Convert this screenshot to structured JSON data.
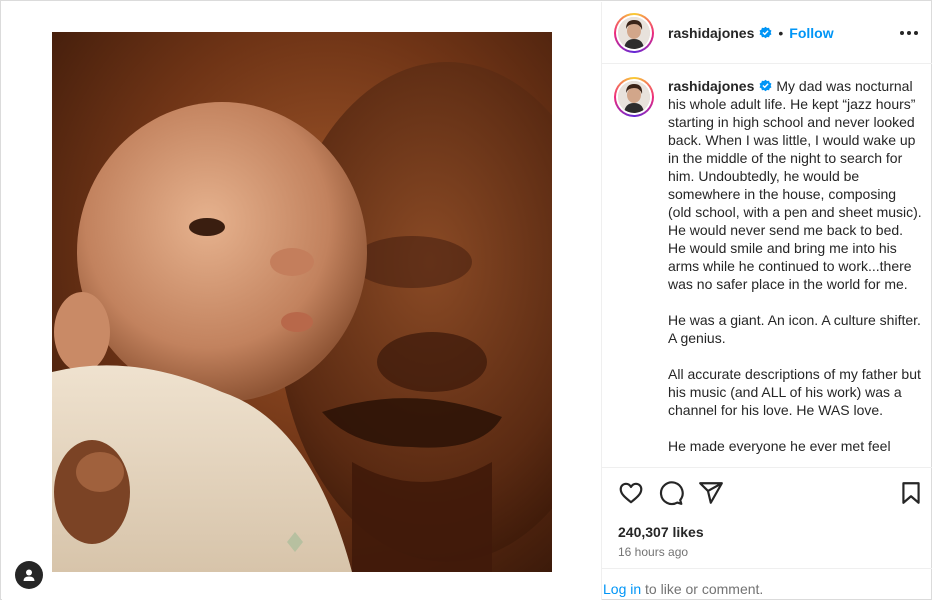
{
  "post": {
    "username": "rashidajones",
    "follow_label": "Follow",
    "separator": "•",
    "caption_paragraphs": [
      "My dad was nocturnal his whole adult life. He kept “jazz hours” starting in high school and never looked back. When I was little, I would wake up in the middle of the night to search for him. Undoubtedly, he would be somewhere in the house, composing (old school, with a pen and sheet music). He would never send me back to bed. He would smile and bring me into his arms while he continued to work...there was no safer place in the world for me.",
      "He was a giant. An icon. A culture shifter. A genius.",
      "All accurate descriptions of my father but his music (and ALL of his work) was a channel for his love. He WAS love.",
      "He made everyone he ever met feel"
    ],
    "likes_text": "240,307 likes",
    "time_text": "16 hours ago",
    "login_link": "Log in",
    "login_suffix": " to like or comment."
  },
  "icons": {
    "verified": "verified-badge-icon",
    "more": "more-options-icon",
    "like": "heart-icon",
    "comment": "comment-icon",
    "share": "share-icon",
    "save": "bookmark-icon",
    "tag": "user-tag-icon"
  },
  "colors": {
    "accent": "#0095f6",
    "text": "#262626",
    "muted": "#737373",
    "border": "#dbdbdb"
  }
}
